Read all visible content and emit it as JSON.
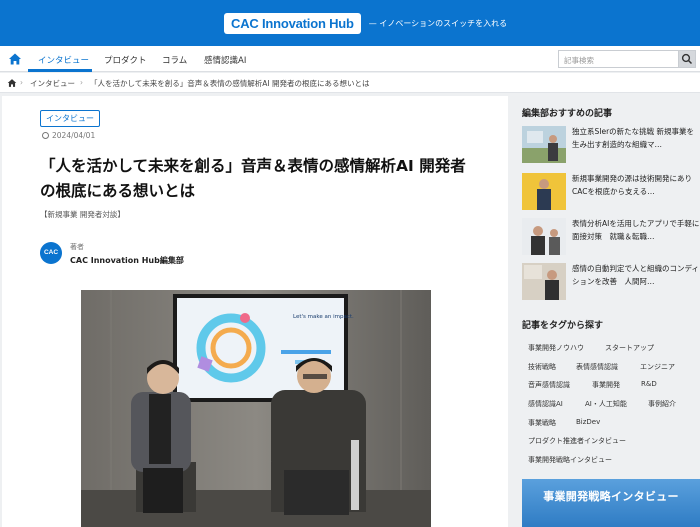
{
  "header": {
    "logo": "CAC Innovation Hub",
    "tagline": "— イノベーションのスイッチを入れる"
  },
  "nav": {
    "items": [
      "インタビュー",
      "プロダクト",
      "コラム",
      "感情認識AI"
    ],
    "active": "インタビュー",
    "search_placeholder": "記事検索"
  },
  "breadcrumb": {
    "items": [
      "インタビュー",
      "「人を活かして未来を創る」音声＆表情の感情解析AI 開発者の根底にある想いとは"
    ]
  },
  "article": {
    "category": "インタビュー",
    "date": "2024/04/01",
    "title": "「人を活かして未来を創る」音声＆表情の感情解析AI 開発者の根底にある想いとは",
    "tags": "【新規事業 開発者対談】",
    "author_label": "著者",
    "author_name": "CAC Innovation Hub編集部",
    "avatar_text": "CAC",
    "screen_text": "Let's make an impact."
  },
  "sidebar": {
    "recommended_heading": "編集部おすすめの記事",
    "recommended": [
      "独立系SIerの新たな挑戦 新規事業を生み出す創造的な組織マ…",
      "新規事業開発の源は技術開発にあり CACを根底から支える…",
      "表情分析AIを活用したアプリで手軽に面接対策　就職＆転職…",
      "感情の自動判定で人と組織のコンディションを改善　人間阿…"
    ],
    "tags_heading": "記事をタグから探す",
    "tags": [
      "事業開発ノウハウ",
      "スタートアップ",
      "技術戦略",
      "表情感情認識",
      "エンジニア",
      "音声感情認識",
      "事業開発",
      "R&D",
      "感情認識AI",
      "AI・人工知能",
      "事例紹介",
      "事業戦略",
      "BizDev",
      "プロダクト推進者インタビュー",
      "事業開発戦略インタビュー"
    ],
    "banner": "事業開発戦略インタビュー"
  },
  "colors": {
    "brand": "#0b74cf",
    "page_bg": "#eef0f2"
  }
}
